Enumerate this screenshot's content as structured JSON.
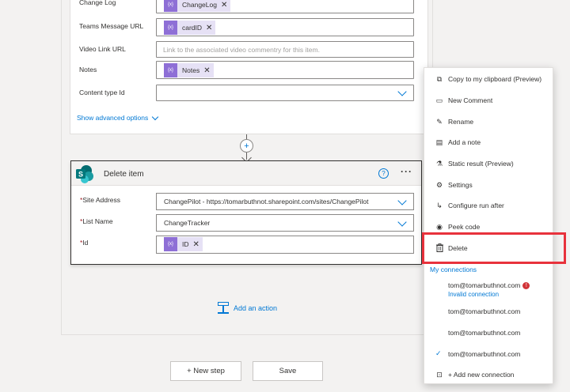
{
  "upper_card": {
    "fields": [
      {
        "label": "Change Log",
        "token": "ChangeLog"
      },
      {
        "label": "Teams Message URL",
        "token": "cardID"
      },
      {
        "label": "Video Link URL",
        "placeholder": "Link to the associated video commentry for this item."
      },
      {
        "label": "Notes",
        "token": "Notes"
      },
      {
        "label": "Content type Id"
      }
    ],
    "show_advanced": "Show advanced options",
    "token_icon": "{x}",
    "token_close": "✕"
  },
  "connector": {
    "plus": "+"
  },
  "delete_card": {
    "title": "Delete item",
    "help": "?",
    "more": "···",
    "required_mark": "*",
    "fields": [
      {
        "label": "Site Address",
        "value": "ChangePilot - https://tomarbuthnot.sharepoint.com/sites/ChangePilot"
      },
      {
        "label": "List Name",
        "value": "ChangeTracker"
      },
      {
        "label": "Id",
        "token": "ID"
      }
    ]
  },
  "add_action": "Add an action",
  "buttons": {
    "new_step": "+ New step",
    "save": "Save"
  },
  "menu": {
    "items": [
      {
        "label": "Copy to my clipboard (Preview)",
        "icon": "copy-icon",
        "glyph": "⧉"
      },
      {
        "label": "New Comment",
        "icon": "comment-icon",
        "glyph": "▭"
      },
      {
        "label": "Rename",
        "icon": "pencil-icon",
        "glyph": "✎"
      },
      {
        "label": "Add a note",
        "icon": "note-icon",
        "glyph": "▤"
      },
      {
        "label": "Static result (Preview)",
        "icon": "beaker-icon",
        "glyph": "⚗"
      },
      {
        "label": "Settings",
        "icon": "gear-icon",
        "glyph": "⚙"
      },
      {
        "label": "Configure run after",
        "icon": "flow-icon",
        "glyph": "↳"
      },
      {
        "label": "Peek code",
        "icon": "eye-icon",
        "glyph": "◉"
      },
      {
        "label": "Delete",
        "icon": "trash-icon",
        "glyph": "🗑"
      }
    ],
    "section": "My connections",
    "connections": [
      {
        "email": "tom@tomarbuthnot.com",
        "status": "Invalid connection",
        "warning": "!"
      },
      {
        "email": "tom@tomarbuthnot.com"
      },
      {
        "email": "tom@tomarbuthnot.com"
      },
      {
        "email": "tom@tomarbuthnot.com",
        "selected": true,
        "check": "✓"
      }
    ],
    "add_connection": "+ Add new connection"
  },
  "colors": {
    "accent": "#0078d4",
    "highlight": "#e8323c",
    "token_bg": "#e6e1f5",
    "token_icon": "#8e6fd6",
    "sharepoint": "#036c70"
  }
}
